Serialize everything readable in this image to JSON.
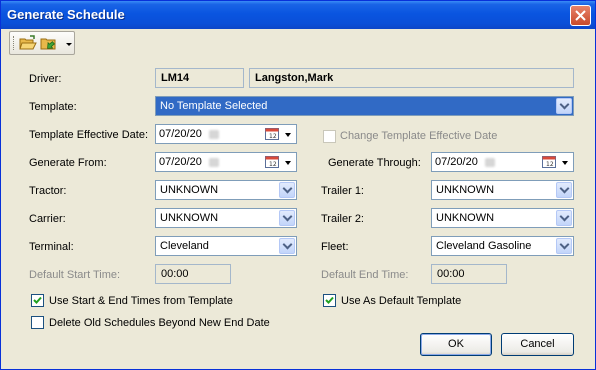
{
  "window": {
    "title": "Generate Schedule"
  },
  "toolbar": {
    "open_icon": "open-folder-icon",
    "export_icon": "export-folder-icon",
    "dropdown_icon": "chevron-down-icon"
  },
  "driver": {
    "label": "Driver:",
    "code": "LM14",
    "name": "Langston,Mark"
  },
  "template": {
    "label": "Template:",
    "value": "No Template Selected"
  },
  "template_effective_date": {
    "label": "Template Effective Date:",
    "value": "07/20/20"
  },
  "change_template_effective_date": {
    "label": "Change Template Effective Date",
    "checked": false,
    "enabled": false
  },
  "generate_from": {
    "label": "Generate From:",
    "value": "07/20/20"
  },
  "generate_through": {
    "label": "Generate Through:",
    "value": "07/20/20"
  },
  "tractor": {
    "label": "Tractor:",
    "value": "UNKNOWN"
  },
  "trailer1": {
    "label": "Trailer 1:",
    "value": "UNKNOWN"
  },
  "carrier": {
    "label": "Carrier:",
    "value": "UNKNOWN"
  },
  "trailer2": {
    "label": "Trailer 2:",
    "value": "UNKNOWN"
  },
  "terminal": {
    "label": "Terminal:",
    "value": "Cleveland"
  },
  "fleet": {
    "label": "Fleet:",
    "value": "Cleveland Gasoline"
  },
  "default_start_time": {
    "label": "Default Start Time:",
    "value": "00:00"
  },
  "default_end_time": {
    "label": "Default End Time:",
    "value": "00:00"
  },
  "use_template_times": {
    "label": "Use Start & End Times from Template",
    "checked": true
  },
  "use_default_template": {
    "label": "Use As Default Template",
    "checked": true
  },
  "delete_old_schedules": {
    "label": "Delete Old Schedules Beyond New End Date",
    "checked": false
  },
  "buttons": {
    "ok": "OK",
    "cancel": "Cancel"
  },
  "colors": {
    "titlebar": "#0a55e0",
    "dialog_bg": "#ece9d8",
    "selection": "#316ac5"
  }
}
